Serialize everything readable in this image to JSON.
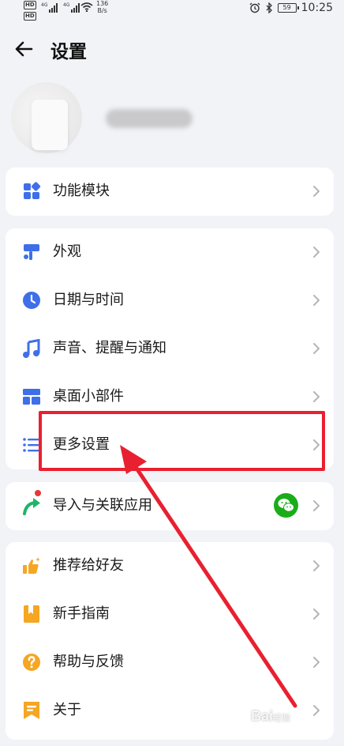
{
  "status_bar": {
    "hd_top": "HD",
    "hd_bottom": "HD",
    "sig1": "4G",
    "sig2": "4G",
    "speed_value": "136",
    "speed_unit": "B/s",
    "battery": "59",
    "time": "10:25"
  },
  "header": {
    "title": "设置"
  },
  "sections": {
    "modules": {
      "items": [
        {
          "label": "功能模块",
          "icon": "grid-modules-icon"
        }
      ]
    },
    "general": {
      "items": [
        {
          "label": "外观",
          "icon": "paint-roller-icon"
        },
        {
          "label": "日期与时间",
          "icon": "clock-icon"
        },
        {
          "label": "声音、提醒与通知",
          "icon": "music-note-icon"
        },
        {
          "label": "桌面小部件",
          "icon": "widget-layout-icon"
        },
        {
          "label": "更多设置",
          "icon": "list-settings-icon"
        }
      ]
    },
    "import": {
      "items": [
        {
          "label": "导入与关联应用",
          "icon": "share-arrow-icon"
        }
      ]
    },
    "about": {
      "items": [
        {
          "label": "推荐给好友",
          "icon": "thumbs-up-icon"
        },
        {
          "label": "新手指南",
          "icon": "guide-book-icon"
        },
        {
          "label": "帮助与反馈",
          "icon": "help-circle-icon"
        },
        {
          "label": "关于",
          "icon": "about-flag-icon"
        }
      ]
    }
  },
  "annotation": {
    "highlight_color": "#e8202f"
  },
  "watermark": {
    "text": "Bai",
    "suffix": "经验"
  },
  "colors": {
    "accent_blue": "#3f6fe8",
    "orange": "#f5a623",
    "green": "#1fb46a",
    "wechat_green": "#1aad19",
    "red": "#e53935"
  }
}
